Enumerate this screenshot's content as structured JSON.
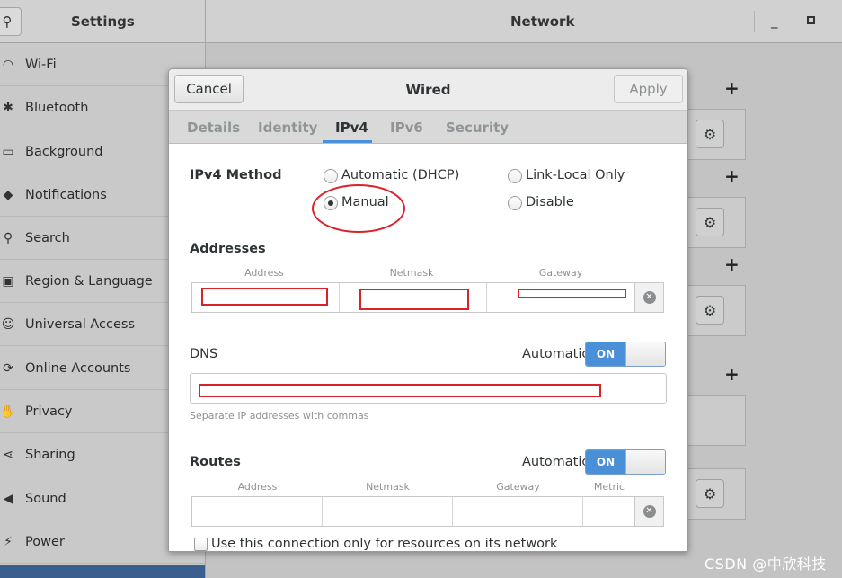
{
  "header": {
    "app_title": "Settings",
    "panel_title": "Network",
    "minimize": "_"
  },
  "sidebar": {
    "items": [
      {
        "label": "Wi-Fi",
        "icon": "wifi-icon",
        "glyph": "◠"
      },
      {
        "label": "Bluetooth",
        "icon": "bluetooth-icon",
        "glyph": "✱"
      },
      {
        "label": "Background",
        "icon": "background-icon",
        "glyph": "▭"
      },
      {
        "label": "Notifications",
        "icon": "bell-icon",
        "glyph": "◆"
      },
      {
        "label": "Search",
        "icon": "search-icon",
        "glyph": "⚲"
      },
      {
        "label": "Region & Language",
        "icon": "camera-icon",
        "glyph": "▣"
      },
      {
        "label": "Universal Access",
        "icon": "accessibility-icon",
        "glyph": "☺"
      },
      {
        "label": "Online Accounts",
        "icon": "online-accounts-icon",
        "glyph": "⟳"
      },
      {
        "label": "Privacy",
        "icon": "hand-icon",
        "glyph": "✋"
      },
      {
        "label": "Sharing",
        "icon": "share-icon",
        "glyph": "⋖"
      },
      {
        "label": "Sound",
        "icon": "speaker-icon",
        "glyph": "◀"
      },
      {
        "label": "Power",
        "icon": "power-icon",
        "glyph": "⚡"
      }
    ]
  },
  "content": {
    "plus_label": "+"
  },
  "dialog": {
    "title": "Wired",
    "cancel_label": "Cancel",
    "apply_label": "Apply",
    "tabs": [
      "Details",
      "Identity",
      "IPv4",
      "IPv6",
      "Security"
    ],
    "active_tab": "IPv4",
    "ipv4_method_label": "IPv4 Method",
    "methods": {
      "automatic_dhcp": "Automatic (DHCP)",
      "link_local": "Link-Local Only",
      "manual": "Manual",
      "disable": "Disable"
    },
    "selected_method": "Manual",
    "addresses": {
      "label": "Addresses",
      "columns": [
        "Address",
        "Netmask",
        "Gateway"
      ],
      "rows": [
        {
          "address": "",
          "netmask": "",
          "gateway": ""
        }
      ]
    },
    "dns": {
      "label": "DNS",
      "automatic_label": "Automatic",
      "switch_label": "ON",
      "value": "",
      "hint": "Separate IP addresses with commas"
    },
    "routes": {
      "label": "Routes",
      "automatic_label": "Automatic",
      "switch_label": "ON",
      "columns": [
        "Address",
        "Netmask",
        "Gateway",
        "Metric"
      ],
      "rows": [
        {
          "address": "",
          "netmask": "",
          "gateway": "",
          "metric": ""
        }
      ]
    },
    "resource_only_label": "Use this connection only for resources on its network"
  },
  "watermark": "CSDN @中欣科技",
  "colors": {
    "accent": "#4a90d9",
    "annotation_red": "#d8232a"
  }
}
